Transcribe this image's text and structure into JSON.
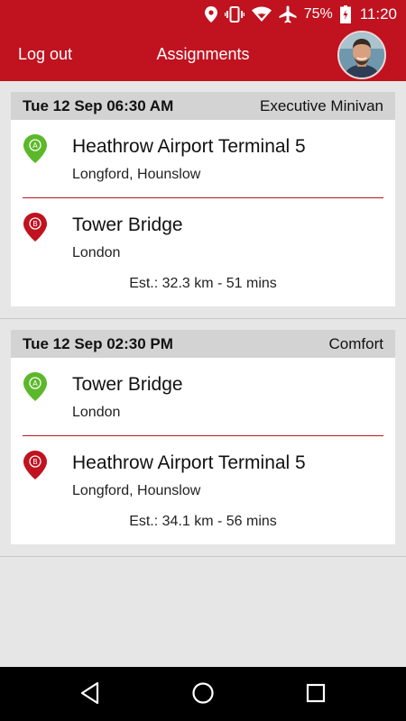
{
  "status_bar": {
    "battery_percent": "75%",
    "time": "11:20"
  },
  "app_bar": {
    "logout_label": "Log out",
    "title": "Assignments"
  },
  "assignments": [
    {
      "date": "Tue 12 Sep 06:30 AM",
      "vehicle": "Executive Minivan",
      "pickup": {
        "marker": "A",
        "place": "Heathrow Airport Terminal 5",
        "area": "Longford, Hounslow"
      },
      "dropoff": {
        "marker": "B",
        "place": "Tower Bridge",
        "area": "London"
      },
      "estimate": "Est.: 32.3 km - 51 mins"
    },
    {
      "date": "Tue 12 Sep 02:30 PM",
      "vehicle": "Comfort",
      "pickup": {
        "marker": "A",
        "place": "Tower Bridge",
        "area": "London"
      },
      "dropoff": {
        "marker": "B",
        "place": "Heathrow Airport Terminal 5",
        "area": "Longford, Hounslow"
      },
      "estimate": "Est.: 34.1 km - 56 mins"
    }
  ],
  "colors": {
    "brand_red": "#c0121f",
    "pickup_green": "#5cb82a",
    "dropoff_red": "#c0121f"
  },
  "icons": {
    "status": [
      "location-icon",
      "vibrate-icon",
      "wifi-icon",
      "airplane-icon",
      "battery-icon"
    ],
    "nav": [
      "back-icon",
      "home-icon",
      "recents-icon"
    ]
  }
}
